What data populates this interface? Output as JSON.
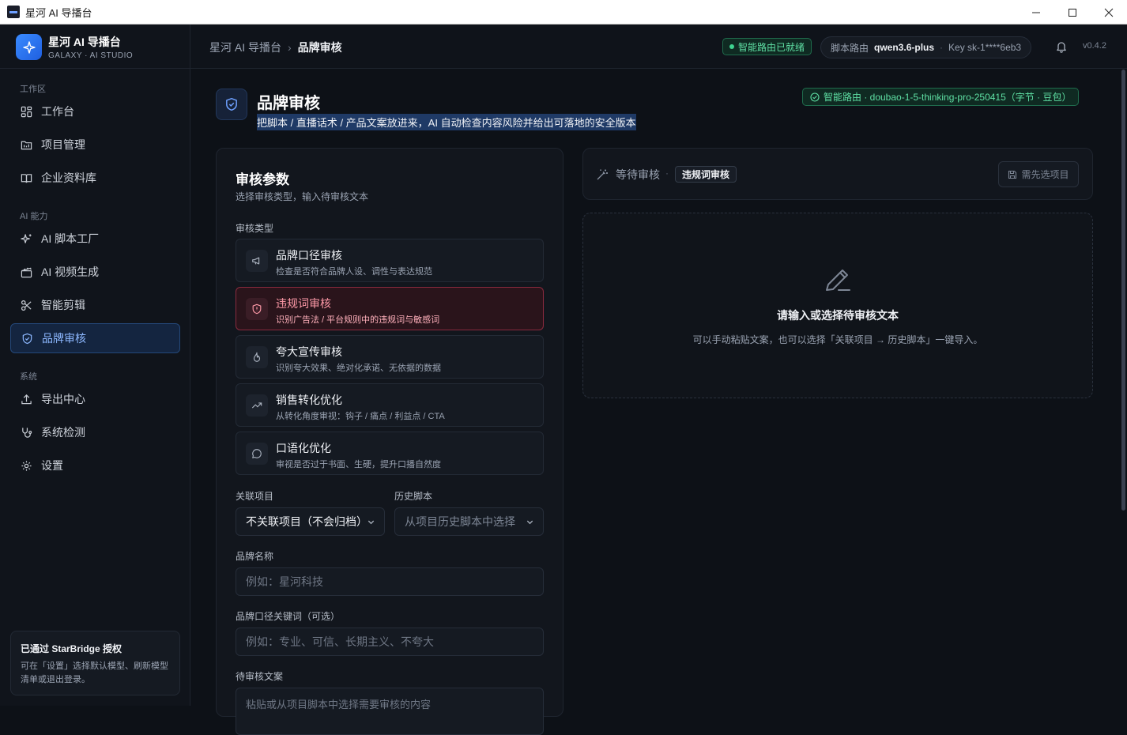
{
  "window": {
    "title": "星河 AI 导播台",
    "controls": [
      "minimize-icon",
      "maximize-icon",
      "close-icon"
    ]
  },
  "sidebar": {
    "brand_name": "星河 AI 导播台",
    "brand_sub": "GALAXY · AI STUDIO",
    "sections": [
      {
        "label": "工作区",
        "items": [
          {
            "label": "工作台",
            "icon": "dashboard-icon"
          },
          {
            "label": "项目管理",
            "icon": "folder-icon"
          },
          {
            "label": "企业资料库",
            "icon": "book-icon"
          }
        ]
      },
      {
        "label": "AI 能力",
        "items": [
          {
            "label": "AI 脚本工厂",
            "icon": "sparkle-icon"
          },
          {
            "label": "AI 视频生成",
            "icon": "clapper-icon"
          },
          {
            "label": "智能剪辑",
            "icon": "scissors-icon"
          },
          {
            "label": "品牌审核",
            "icon": "shield-icon",
            "active": true
          }
        ]
      },
      {
        "label": "系统",
        "items": [
          {
            "label": "导出中心",
            "icon": "upload-icon"
          },
          {
            "label": "系统检测",
            "icon": "stethoscope-icon"
          },
          {
            "label": "设置",
            "icon": "gear-icon"
          }
        ]
      }
    ],
    "auth": {
      "title": "已通过 StarBridge 授权",
      "desc": "可在「设置」选择默认模型、刷新模型清单或退出登录。"
    }
  },
  "header": {
    "breadcrumb_root": "星河 AI 导播台",
    "breadcrumb_current": "品牌审核",
    "ready_badge": "智能路由已就绪",
    "route_label": "脚本路由",
    "route_model": "qwen3.6-plus",
    "key_label": "Key sk-1****6eb3",
    "version": "v0.4.2"
  },
  "page": {
    "title": "品牌审核",
    "subtitle": "把脚本 / 直播话术 / 产品文案放进来，AI 自动检查内容风险并给出可落地的安全版本",
    "route_badge": "智能路由 · doubao-1-5-thinking-pro-250415（字节 · 豆包）"
  },
  "params": {
    "title": "审核参数",
    "subtitle": "选择审核类型，输入待审核文本",
    "type_label": "审核类型",
    "types": [
      {
        "title": "品牌口径审核",
        "desc": "检查是否符合品牌人设、调性与表达规范",
        "icon": "megaphone-icon",
        "selected": false
      },
      {
        "title": "违规词审核",
        "desc": "识别广告法 / 平台规则中的违规词与敏感词",
        "icon": "shield-alert-icon",
        "selected": true
      },
      {
        "title": "夸大宣传审核",
        "desc": "识别夸大效果、绝对化承诺、无依据的数据",
        "icon": "flame-icon",
        "selected": false
      },
      {
        "title": "销售转化优化",
        "desc": "从转化角度审视：钩子 / 痛点 / 利益点 / CTA",
        "icon": "trending-up-icon",
        "selected": false
      },
      {
        "title": "口语化优化",
        "desc": "审视是否过于书面、生硬，提升口播自然度",
        "icon": "chat-bubble-icon",
        "selected": false
      }
    ],
    "project_label": "关联项目",
    "project_value": "不关联项目（不会归档）",
    "history_label": "历史脚本",
    "history_placeholder": "从项目历史脚本中选择",
    "brand_label": "品牌名称",
    "brand_placeholder": "例如：星河科技",
    "keywords_label": "品牌口径关键词（可选）",
    "keywords_placeholder": "例如：专业、可信、长期主义、不夸大",
    "text_label": "待审核文案",
    "text_placeholder": "粘贴或从项目脚本中选择需要审核的内容"
  },
  "status": {
    "wait": "等待审核",
    "tag": "违规词审核",
    "button": "需先选项目"
  },
  "empty": {
    "title": "请输入或选择待审核文本",
    "desc": "可以手动粘贴文案，也可以选择「关联项目 → 历史脚本」一键导入。"
  },
  "colors": {
    "accent": "#3a8bff",
    "success": "#3ed28f",
    "danger": "#ff9aa8",
    "background": "#0d1117"
  }
}
